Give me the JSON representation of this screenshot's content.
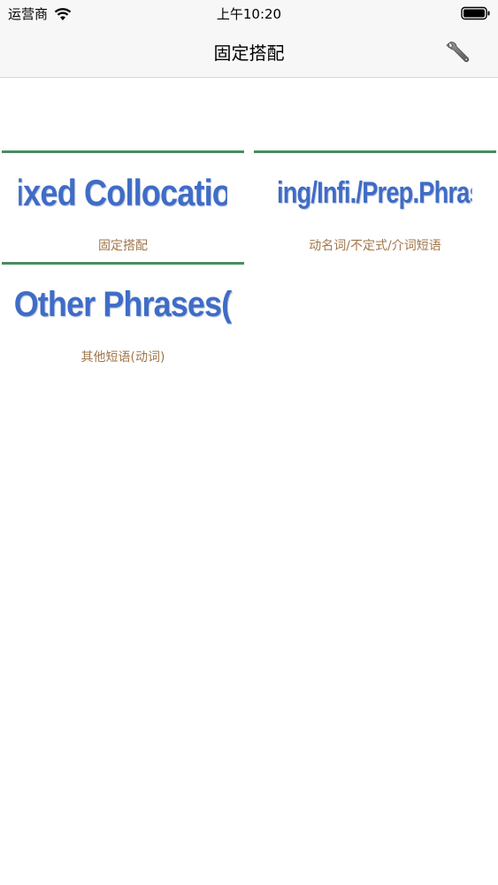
{
  "status_bar": {
    "carrier": "运营商",
    "time": "上午10:20"
  },
  "nav": {
    "title": "固定搭配",
    "settings_icon": "wrench-icon"
  },
  "colors": {
    "divider": "#4a8b63",
    "logo_text": "#3f6cc6",
    "caption_text": "#a0764a"
  },
  "categories": [
    {
      "logo": "Fixed Collocation",
      "caption": "固定搭配"
    },
    {
      "logo": "V-ing/Infi./Prep.Phrase",
      "caption": "动名词/不定式/介词短语"
    },
    {
      "logo": "Other Phrases(V.)",
      "caption": "其他短语(动词)"
    }
  ]
}
